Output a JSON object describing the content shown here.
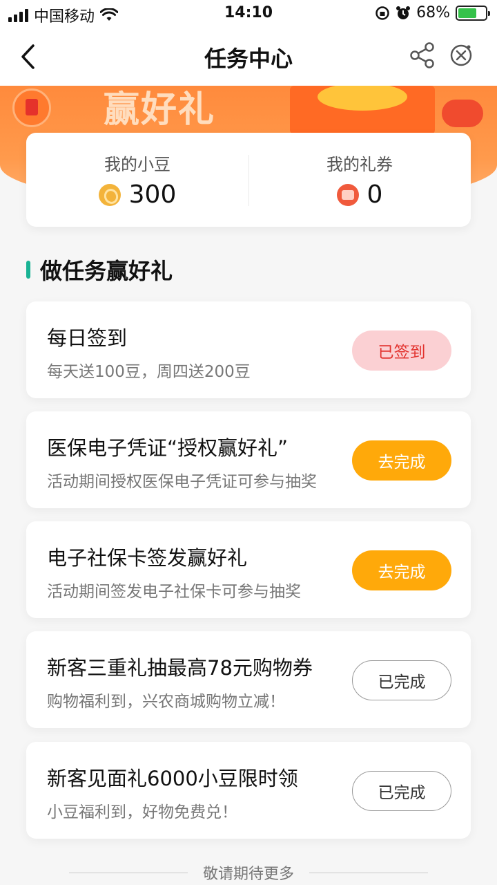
{
  "status_bar": {
    "carrier": "中国移动",
    "time": "14:10",
    "battery": "68%",
    "battery_level": 0.68
  },
  "nav": {
    "title": "任务中心"
  },
  "banner": {
    "text": "赢好礼"
  },
  "summary": {
    "beans_label": "我的小豆",
    "beans_value": "300",
    "coupons_label": "我的礼券",
    "coupons_value": "0"
  },
  "section": {
    "title": "做任务赢好礼"
  },
  "tasks": [
    {
      "title": "每日签到",
      "desc": "每天送100豆，周四送200豆",
      "button": "已签到",
      "state": "signed"
    },
    {
      "title": "医保电子凭证“授权赢好礼”",
      "desc": "活动期间授权医保电子凭证可参与抽奖",
      "button": "去完成",
      "state": "todo"
    },
    {
      "title": "电子社保卡签发赢好礼",
      "desc": "活动期间签发电子社保卡可参与抽奖",
      "button": "去完成",
      "state": "todo"
    },
    {
      "title": "新客三重礼抽最高78元购物券",
      "desc": "购物福利到，兴农商城购物立减！",
      "button": "已完成",
      "state": "done"
    },
    {
      "title": "新客见面礼6000小豆限时领",
      "desc": "小豆福利到，好物免费兑！",
      "button": "已完成",
      "state": "done"
    }
  ],
  "footer": {
    "text": "敬请期待更多"
  },
  "colors": {
    "accent_green": "#19b394",
    "button_orange": "#ffa90a",
    "signed_pink": "#fbd0d3",
    "signed_red": "#e2322e",
    "banner_orange": "#ff8a3c"
  }
}
